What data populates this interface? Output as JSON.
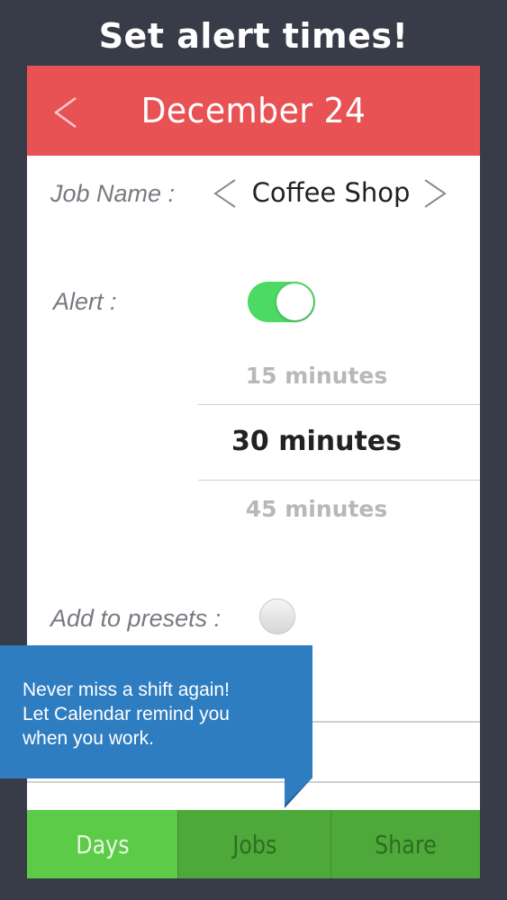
{
  "promo": {
    "title": "Set alert times!"
  },
  "header": {
    "back_icon": "chevron-left-icon",
    "date": "December 24"
  },
  "job": {
    "label": "Job Name :",
    "value": "Coffee Shop",
    "prev_icon": "chevron-left-icon",
    "next_icon": "chevron-right-icon"
  },
  "alert": {
    "label": "Alert :",
    "enabled": true,
    "options": [
      "15 minutes",
      "30 minutes",
      "45 minutes"
    ],
    "selected": "30 minutes"
  },
  "presets": {
    "label": "Add to presets :",
    "checked": false
  },
  "tooltip": {
    "text": "Never miss a shift again!\nLet Calendar remind you\nwhen you work."
  },
  "tabs": [
    {
      "label": "Days",
      "active": true
    },
    {
      "label": "Jobs",
      "active": false
    },
    {
      "label": "Share",
      "active": false
    }
  ],
  "colors": {
    "background": "#383b48",
    "header": "#e85255",
    "toggle_on": "#4cd964",
    "tab_active": "#5ccb47",
    "tab_inactive": "#4ea83a",
    "tooltip": "#2f7dc1"
  }
}
